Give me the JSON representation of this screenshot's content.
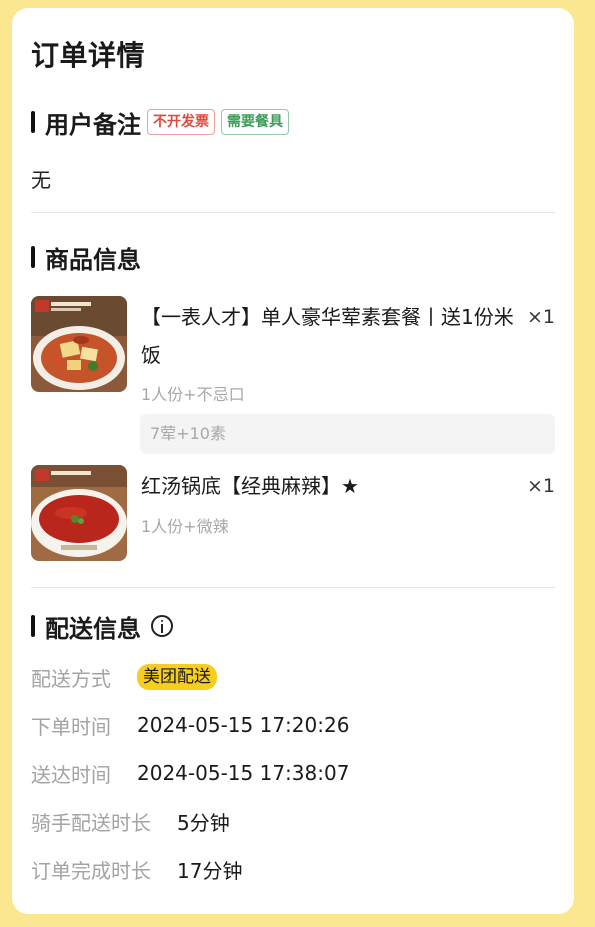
{
  "page": {
    "title": "订单详情"
  },
  "remark": {
    "title": "用户备注",
    "tags": [
      "不开发票",
      "需要餐具"
    ],
    "text": "无"
  },
  "products": {
    "title": "商品信息",
    "items": [
      {
        "name": "【一表人才】单人豪华荤素套餐丨送1份米饭",
        "qty": "×1",
        "spec": "1人份+不忌口",
        "detail": "7荤+10素"
      },
      {
        "name": "红汤锅底【经典麻辣】★",
        "qty": "×1",
        "spec": "1人份+微辣"
      }
    ]
  },
  "delivery": {
    "title": "配送信息",
    "info_icon": "info-icon",
    "rows": [
      {
        "label": "配送方式",
        "value": "美团配送"
      },
      {
        "label": "下单时间",
        "value": "2024-05-15 17:20:26"
      },
      {
        "label": "送达时间",
        "value": "2024-05-15 17:38:07"
      },
      {
        "label": "骑手配送时长",
        "value": "5分钟"
      },
      {
        "label": "订单完成时长",
        "value": "17分钟"
      }
    ]
  },
  "colors": {
    "background": "#fbe78f",
    "tag_red": "#e0483a",
    "tag_green": "#3e9d5a",
    "delivery_chip": "#f7cd1f"
  }
}
